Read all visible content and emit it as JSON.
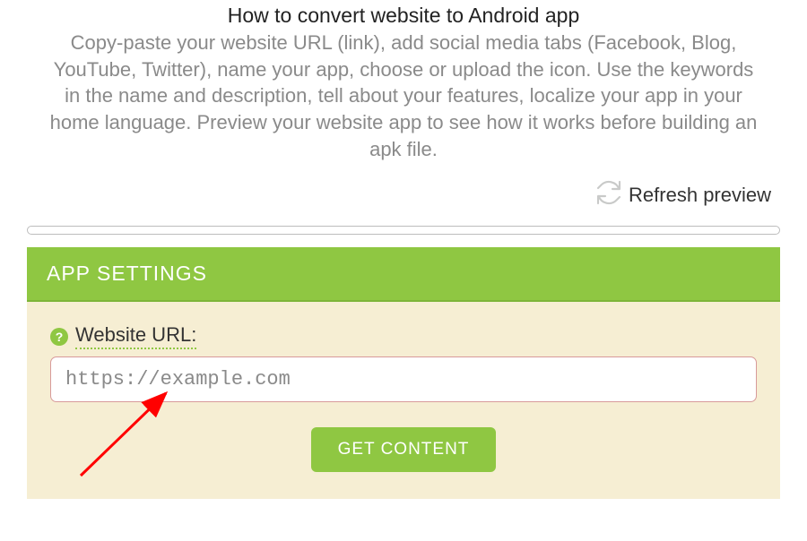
{
  "page": {
    "title": "How to convert website to Android app",
    "description": "Copy-paste your website URL (link), add social media tabs (Facebook, Blog, YouTube, Twitter), name your app, choose or upload the icon. Use the keywords in the name and description, tell about your features, localize your app in your home language. Preview your website app to see how it works before building an apk file."
  },
  "refresh": {
    "label": "Refresh preview"
  },
  "panel": {
    "header": "APP SETTINGS",
    "help_symbol": "?",
    "url_label": "Website URL:",
    "url_value": "https://example.com",
    "button_label": "GET CONTENT"
  },
  "colors": {
    "accent": "#8fc742",
    "panel_bg": "#f6eed3",
    "arrow": "#ff0000"
  }
}
